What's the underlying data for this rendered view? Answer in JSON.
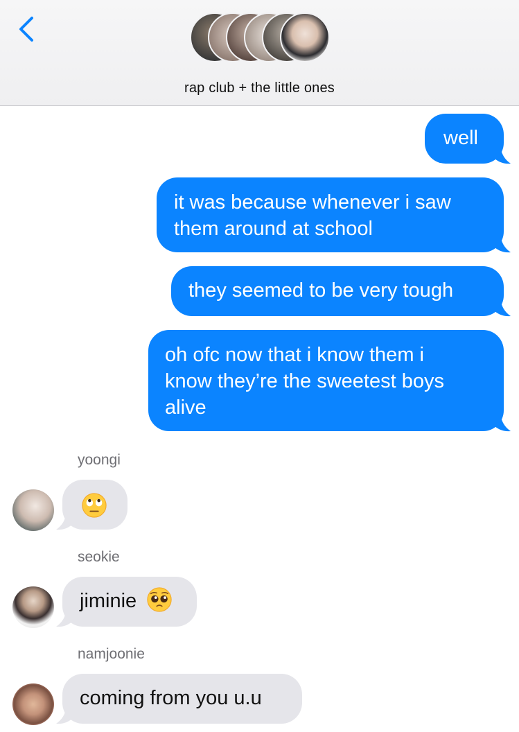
{
  "header": {
    "back_icon": "chevron-left-icon",
    "group_title": "rap club + the little ones",
    "accent_color": "#0b84ff",
    "members": [
      "member-1",
      "member-2",
      "member-3",
      "member-4",
      "member-5",
      "member-6"
    ]
  },
  "messages": [
    {
      "direction": "outgoing",
      "text": "well"
    },
    {
      "direction": "outgoing",
      "lines": [
        "it was because whenever i saw",
        "them around at school"
      ]
    },
    {
      "direction": "outgoing",
      "text": "they seemed to be very tough"
    },
    {
      "direction": "outgoing",
      "lines": [
        "oh ofc now that i know them i",
        "know they’re the sweetest boys",
        "alive"
      ]
    },
    {
      "direction": "incoming",
      "sender": "yoongi",
      "emoji": "face-with-rolling-eyes-icon"
    },
    {
      "direction": "incoming",
      "sender": "seokie",
      "text": "jiminie",
      "emoji": "pleading-face-icon"
    },
    {
      "direction": "incoming",
      "sender": "namjoonie",
      "text": "coming from you u.u"
    }
  ],
  "colors": {
    "outgoing_bubble": "#0b84ff",
    "incoming_bubble": "#e5e5ea",
    "sender_name": "#6e6e73"
  }
}
